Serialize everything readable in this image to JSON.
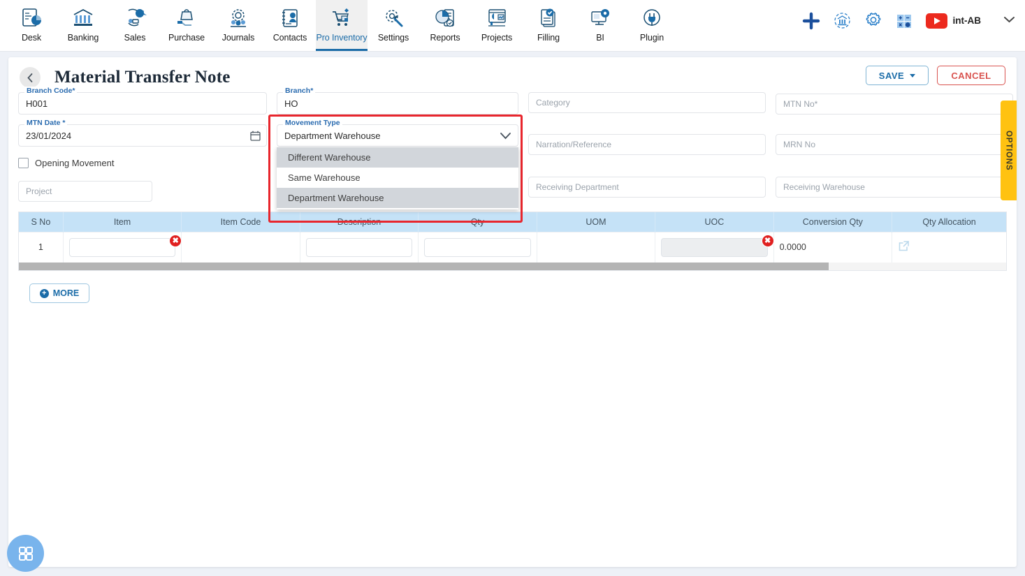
{
  "topnav": {
    "items": [
      {
        "label": "Desk",
        "icon": "desk-chart-icon",
        "active": false
      },
      {
        "label": "Banking",
        "icon": "bank-building-icon",
        "active": false
      },
      {
        "label": "Sales",
        "icon": "sales-megaphone-icon",
        "active": false
      },
      {
        "label": "Purchase",
        "icon": "purchase-hand-bag-icon",
        "active": false
      },
      {
        "label": "Journals",
        "icon": "journals-gear-people-icon",
        "active": false
      },
      {
        "label": "Contacts",
        "icon": "contacts-book-icon",
        "active": false
      },
      {
        "label": "Pro Inventory",
        "icon": "inventory-cart-icon",
        "active": true
      },
      {
        "label": "Settings",
        "icon": "settings-gear-wrench-icon",
        "active": false
      },
      {
        "label": "Reports",
        "icon": "reports-pie-doc-icon",
        "active": false
      },
      {
        "label": "Projects",
        "icon": "projects-dashboard-icon",
        "active": false
      },
      {
        "label": "Filling",
        "icon": "filling-check-doc-icon",
        "active": false
      },
      {
        "label": "BI",
        "icon": "bi-monitor-gear-icon",
        "active": false
      },
      {
        "label": "Plugin",
        "icon": "plugin-plug-icon",
        "active": false
      }
    ],
    "right": {
      "add_icon": "plus-icon",
      "refresh_bank_icon": "refresh-bank-icon",
      "settings_icon": "gear-icon",
      "calculator_icon": "calculator-icon",
      "video_icon": "youtube-play-icon",
      "account_label": "int-AB",
      "chevron_icon": "chevron-down-icon"
    }
  },
  "page": {
    "back_icon": "chevron-left-icon",
    "title": "Material Transfer Note",
    "save_label": "SAVE",
    "cancel_label": "CANCEL",
    "options_tab_label": "OPTIONS",
    "fab_icon": "apps-grid-icon"
  },
  "form": {
    "branch_code": {
      "legend": "Branch Code",
      "required": true,
      "value": "H001"
    },
    "branch": {
      "legend": "Branch",
      "required": true,
      "value": "HO"
    },
    "category": {
      "placeholder": "Category"
    },
    "mtn_no": {
      "placeholder": "MTN No",
      "required": true
    },
    "mtn_date": {
      "legend": "MTN Date",
      "required": true,
      "value": "23/01/2024",
      "calendar_icon": "calendar-icon"
    },
    "movement_type": {
      "legend": "Movement Type",
      "value": "Department Warehouse",
      "chevron_icon": "chevron-down-icon",
      "options": [
        {
          "label": "Different Warehouse",
          "highlighted": true
        },
        {
          "label": "Same Warehouse",
          "highlighted": false
        },
        {
          "label": "Department Warehouse",
          "highlighted": true
        }
      ]
    },
    "narration": {
      "placeholder": "Narration/Reference"
    },
    "mrn_no": {
      "placeholder": "MRN No"
    },
    "opening_movement": {
      "label": "Opening Movement",
      "checked": false
    },
    "receiving_department": {
      "placeholder": "Receiving Department"
    },
    "receiving_warehouse": {
      "placeholder": "Receiving Warehouse"
    },
    "project": {
      "placeholder": "Project"
    }
  },
  "table": {
    "columns": [
      "S No",
      "Item",
      "Item Code",
      "Description",
      "Qty",
      "UOM",
      "UOC",
      "Conversion Qty",
      "Qty Allocation"
    ],
    "rows": [
      {
        "s_no": "1",
        "item": "",
        "item_error": true,
        "item_code": "",
        "description": "",
        "qty": "",
        "uom": "",
        "uoc": "",
        "uoc_error": true,
        "conversion_qty": "0.0000",
        "qty_allocation_icon": "external-link-icon"
      }
    ],
    "error_badge_glyph": "✖",
    "scroll_percent": 82
  },
  "more_button": {
    "label": "MORE",
    "icon": "plus-circle-icon"
  },
  "colors": {
    "accent_blue": "#1b6ca8",
    "header_blue": "#c5e2f7",
    "error_red": "#e02020",
    "highlight_red": "#e8262d",
    "options_yellow": "#ffc211",
    "fab_blue": "#79b4ec",
    "youtube_red": "#ec2a1e"
  }
}
